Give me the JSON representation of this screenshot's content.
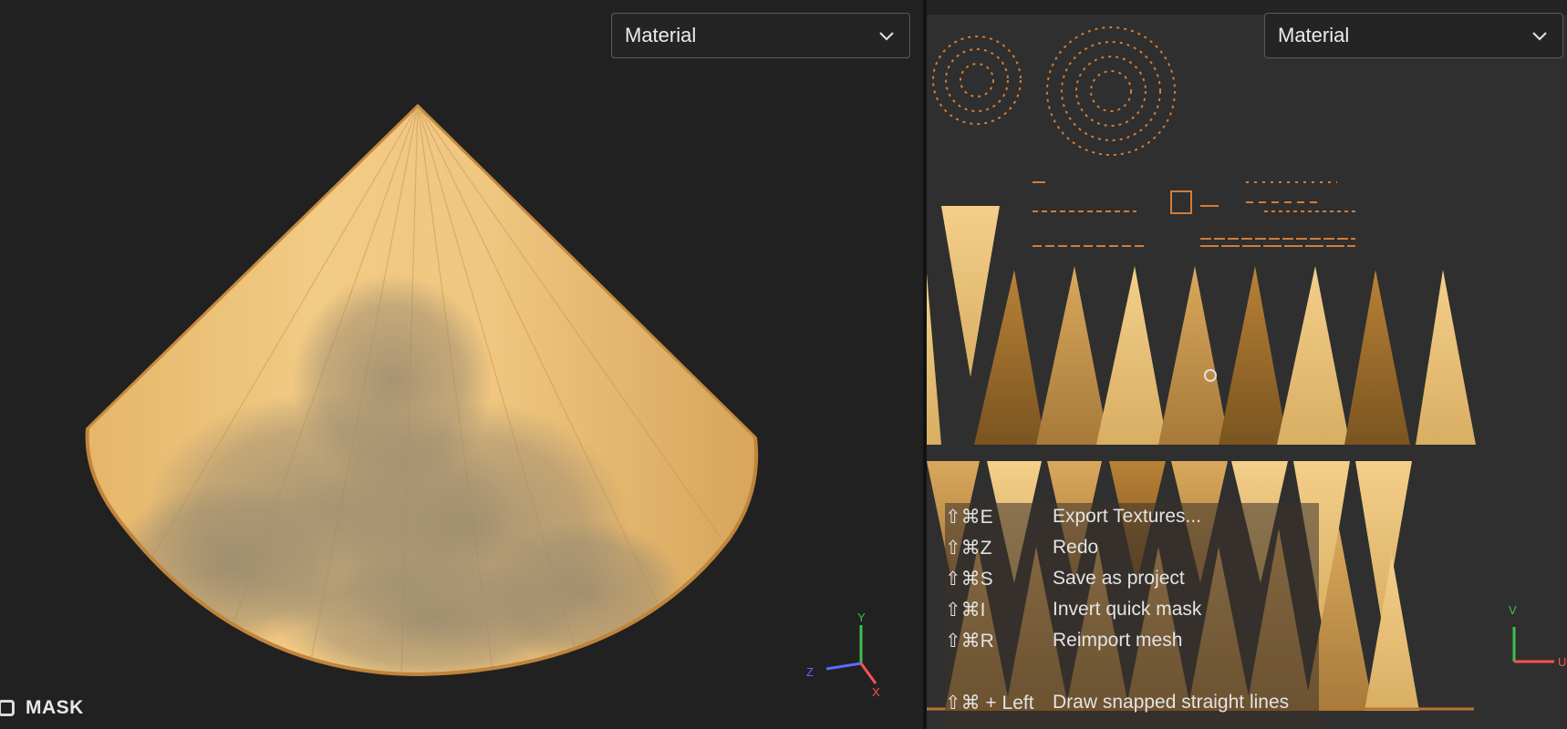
{
  "viewports": {
    "left": {
      "mode_select": {
        "value": "Material"
      }
    },
    "right": {
      "mode_select": {
        "value": "Material"
      }
    }
  },
  "gizmo_3d": {
    "axes": [
      "Y",
      "Z",
      "X"
    ],
    "colors": {
      "y": "#3fbf4a",
      "z": "#5a6cff",
      "x": "#ff5050"
    }
  },
  "gizmo_2d": {
    "axes": [
      "V",
      "U"
    ],
    "colors": {
      "v": "#3fbf4a",
      "u": "#ff5050"
    }
  },
  "mask": {
    "label": "MASK"
  },
  "shortcuts": [
    {
      "key": "⇧⌘E",
      "action": "Export Textures..."
    },
    {
      "key": "⇧⌘Z",
      "action": "Redo"
    },
    {
      "key": "⇧⌘S",
      "action": "Save as project"
    },
    {
      "key": "⇧⌘I",
      "action": "Invert quick mask"
    },
    {
      "key": "⇧⌘R",
      "action": "Reimport mesh"
    },
    {
      "key": "⇧⌘ + Left",
      "action": "Draw snapped straight lines"
    }
  ],
  "colors": {
    "straw_light": "#f0c983",
    "straw_mid": "#d9a85c",
    "straw_dark": "#8a5e22",
    "panel_bg": "#2f2f2f",
    "viewport_bg": "#212121"
  }
}
